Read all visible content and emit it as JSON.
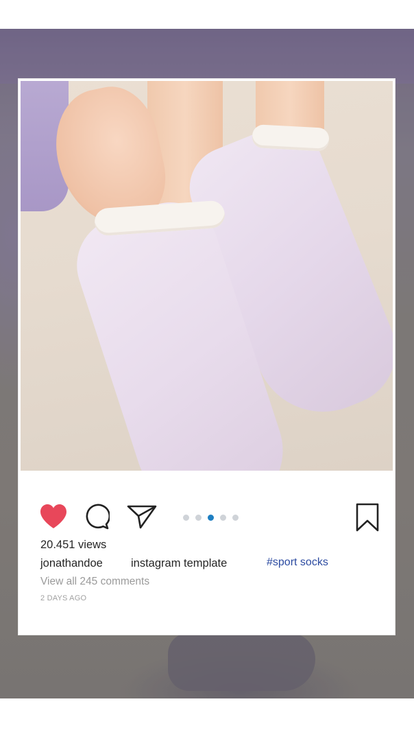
{
  "post": {
    "views": "20.451 views",
    "username": "jonathandoe",
    "caption": "instagram template",
    "hashtag": "#sport socks",
    "comments_link": "View all 245 comments",
    "timestamp": "2 DAYS AGO"
  },
  "carousel": {
    "count": 5,
    "active_index": 2
  },
  "icons": {
    "like": "heart-icon",
    "comment": "comment-icon",
    "share": "share-icon",
    "save": "bookmark-icon"
  },
  "colors": {
    "heart": "#e8475a",
    "active_dot": "#1e7fc2",
    "hashtag": "#2b4aa0"
  }
}
